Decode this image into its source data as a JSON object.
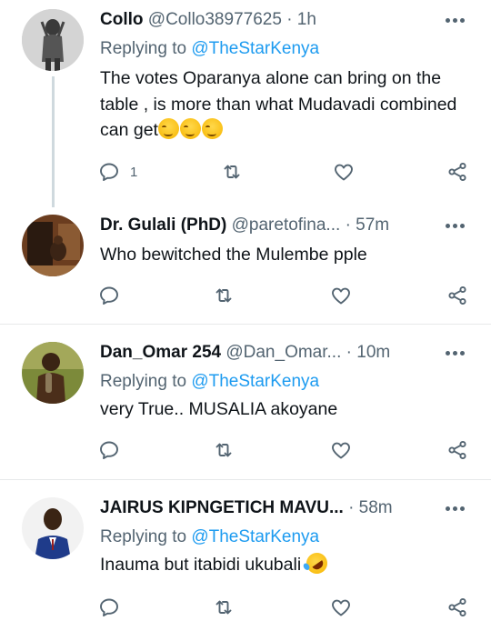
{
  "tweets": [
    {
      "name": "Collo",
      "handle": "@Collo38977625",
      "time": "· 1h",
      "replying_prefix": "Replying to",
      "replying_to": "@TheStarKenya",
      "text": "The votes Oparanya alone can bring on the table , is more than what Mudavadi combined can get",
      "emoji_icon": "relieved-face-emoji",
      "emoji_count": 3,
      "reply_count": "1"
    },
    {
      "name": "Dr. Gulali (PhD)",
      "handle": "@paretofina...",
      "time": "· 57m",
      "text": "Who bewitched the Mulembe pple",
      "reply_count": ""
    },
    {
      "name": "Dan_Omar 254",
      "handle": "@Dan_Omar...",
      "time": "· 10m",
      "replying_prefix": "Replying to",
      "replying_to": "@TheStarKenya",
      "text": "very True.. MUSALIA akoyane",
      "reply_count": ""
    },
    {
      "name": "JAIRUS KIPNGETICH MAVU...",
      "handle": "",
      "time": "· 58m",
      "replying_prefix": "Replying to",
      "replying_to": "@TheStarKenya",
      "text": "Inauma but itabidi ukubali",
      "emoji_icon": "rolling-on-floor-laughing-emoji",
      "reply_count": ""
    }
  ],
  "colors": {
    "text": "#0f1419",
    "secondary": "#536471",
    "accent": "#1d9bf0",
    "divider": "#e7e9ea",
    "thread_line": "#cfd9de"
  },
  "icons": [
    "reply-icon",
    "retweet-icon",
    "like-icon",
    "share-icon",
    "more-icon"
  ]
}
